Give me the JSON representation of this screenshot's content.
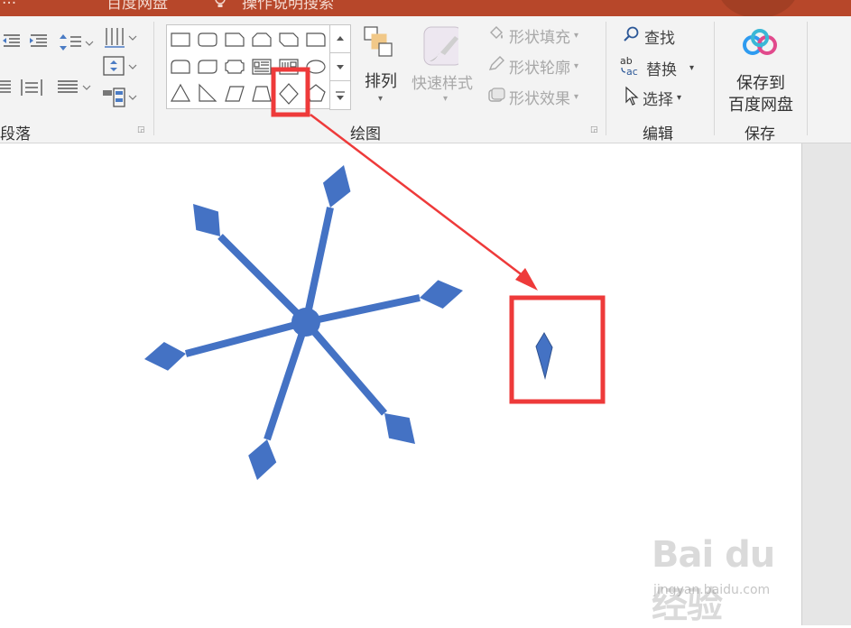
{
  "titlebar": {
    "left_text": "...",
    "baidu_drive_text": "百度网盘",
    "search_text": "操作说明搜索"
  },
  "ribbon": {
    "paragraph": {
      "label": "段落"
    },
    "drawing": {
      "label": "绘图",
      "arrange_label": "排列",
      "quick_styles_label": "快速样式",
      "shape_fill_label": "形状填充",
      "shape_outline_label": "形状轮廓",
      "shape_effects_label": "形状效果"
    },
    "editing": {
      "label": "编辑",
      "find_label": "查找",
      "replace_label": "替换",
      "select_label": "选择"
    },
    "save": {
      "label": "保存",
      "save_to_line1": "保存到",
      "save_to_line2": "百度网盘"
    }
  },
  "gallery": {
    "shapes_row1": [
      "rectangle-icon",
      "rounded-rectangle-icon",
      "snip-corner-rectangle-icon",
      "snip-same-side-rectangle-icon",
      "snip-diagonal-rectangle-icon",
      "round-corner-rectangle-icon"
    ],
    "shapes_row2": [
      "round-same-side-rectangle-icon",
      "round-diagonal-rectangle-icon",
      "plaque-icon",
      "text-box-icon",
      "vertical-text-box-icon",
      "oval-icon"
    ],
    "shapes_row3": [
      "triangle-icon",
      "right-triangle-icon",
      "parallelogram-icon",
      "trapezoid-icon",
      "diamond-icon",
      "pentagon-icon"
    ],
    "highlight_shape": "diamond-icon"
  },
  "slide": {
    "shape_color": "#4472c4",
    "annotation_color": "#ee3a3a"
  },
  "watermark": {
    "logo_text": "Bai du 经验",
    "url_text": "jingyan.baidu.com"
  }
}
